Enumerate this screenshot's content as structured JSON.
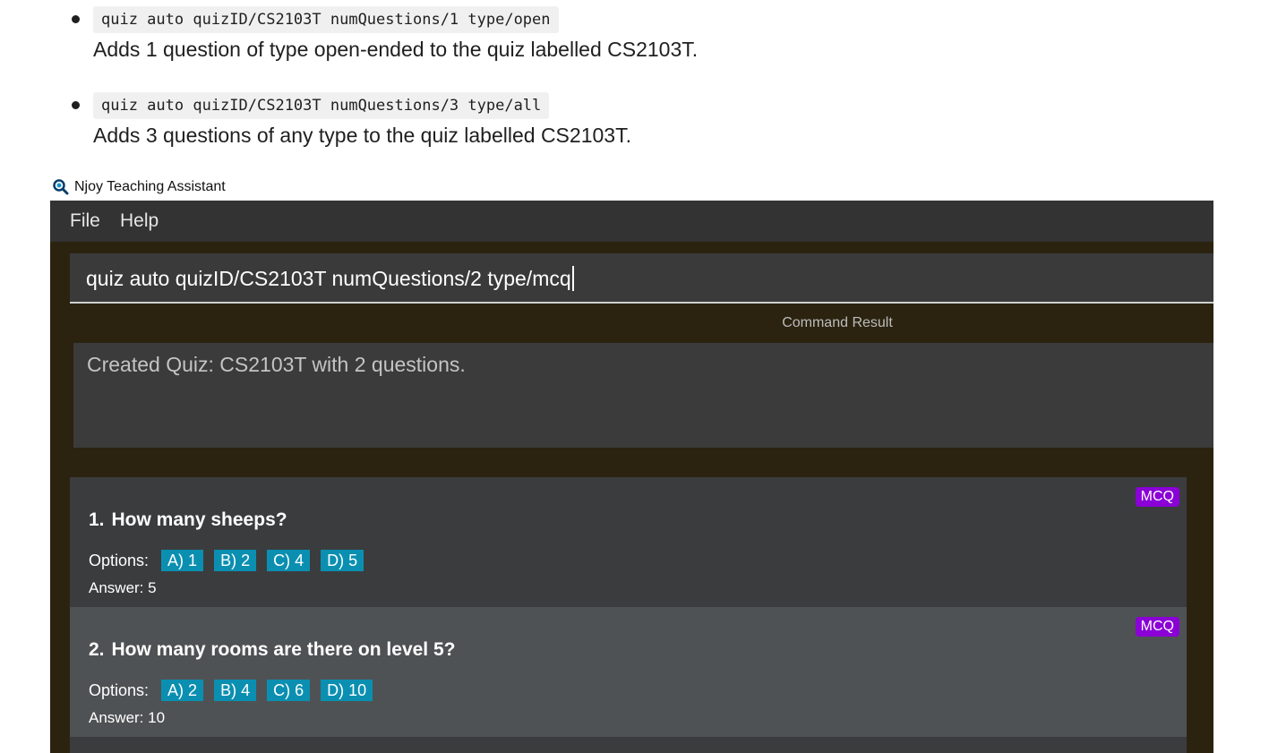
{
  "doc": {
    "examples": [
      {
        "command": "quiz auto quizID/CS2103T numQuestions/1 type/open",
        "description": "Adds 1 question of type open-ended to the quiz labelled CS2103T."
      },
      {
        "command": "quiz auto quizID/CS2103T numQuestions/3 type/all",
        "description": "Adds 3 questions of any type to the quiz labelled CS2103T."
      }
    ]
  },
  "window": {
    "title": "Njoy Teaching Assistant",
    "icon": "magnifier-icon"
  },
  "menu": {
    "items": [
      "File",
      "Help"
    ]
  },
  "command_box": {
    "value": "quiz auto quizID/CS2103T numQuestions/2 type/mcq"
  },
  "result": {
    "label": "Command Result",
    "text": "Created Quiz: CS2103T with 2 questions."
  },
  "questions": [
    {
      "number": "1.",
      "title": "How many sheeps?",
      "type": "MCQ",
      "options_label": "Options:",
      "options": [
        "A) 1",
        "B) 2",
        "C) 4",
        "D) 5"
      ],
      "answer": "Answer: 5"
    },
    {
      "number": "2.",
      "title": "How many rooms are there on level 5?",
      "type": "MCQ",
      "options_label": "Options:",
      "options": [
        "A) 2",
        "B) 4",
        "C) 6",
        "D) 10"
      ],
      "answer": "Answer: 10"
    }
  ],
  "colors": {
    "app_background": "#2b230f",
    "menubar": "#333333",
    "mcq_badge": "#8a00d6",
    "option_tag": "#0b8fb1"
  }
}
